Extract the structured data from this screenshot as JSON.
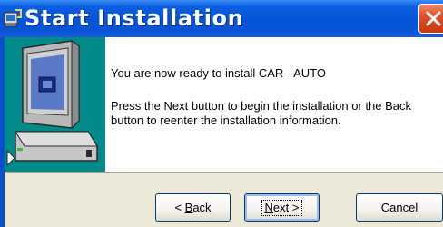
{
  "window": {
    "title": "Start Installation",
    "icon": "installer-app-icon",
    "close_icon": "close-icon"
  },
  "content": {
    "ready_text": "You are now ready to install CAR - AUTO",
    "instructions_line1": "Press the Next button to begin the installation or the Back",
    "instructions_line2": "button to reenter the installation information."
  },
  "sidebar": {
    "image": "computer-icon"
  },
  "buttons": {
    "back": {
      "mnemonic": "B",
      "rest": "ack",
      "prefix": "< "
    },
    "next": {
      "mnemonic": "N",
      "rest": "ext >"
    },
    "cancel": "Cancel"
  },
  "colors": {
    "titlebar": "#0453d6",
    "sidebar": "#008a8a",
    "close_button": "#e0502a",
    "dialog_background": "#ece9d8"
  }
}
